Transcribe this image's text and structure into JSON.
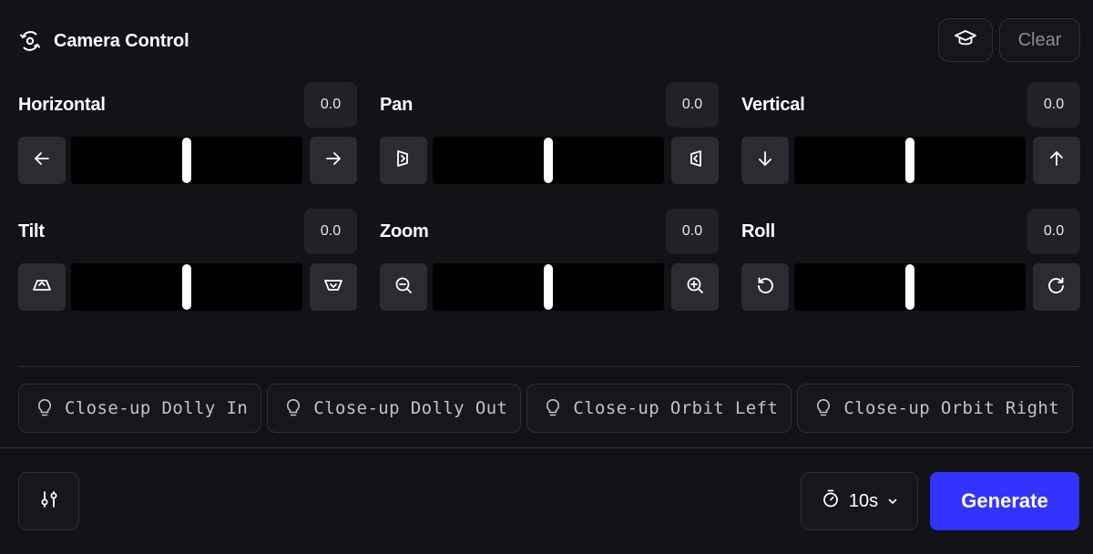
{
  "header": {
    "title": "Camera Control",
    "title_icon": "camera-orbit-icon",
    "learn_icon": "graduation-cap-icon",
    "clear_label": "Clear"
  },
  "controls": [
    {
      "label": "Horizontal",
      "value": "0.0",
      "level": 0.5,
      "left_icon": "arrow-left-icon",
      "right_icon": "arrow-right-icon"
    },
    {
      "label": "Pan",
      "value": "0.0",
      "level": 0.5,
      "left_icon": "pan-left-icon",
      "right_icon": "pan-right-icon"
    },
    {
      "label": "Vertical",
      "value": "0.0",
      "level": 0.5,
      "left_icon": "arrow-down-icon",
      "right_icon": "arrow-up-icon"
    },
    {
      "label": "Tilt",
      "value": "0.0",
      "level": 0.5,
      "left_icon": "tilt-down-icon",
      "right_icon": "tilt-up-icon"
    },
    {
      "label": "Zoom",
      "value": "0.0",
      "level": 0.5,
      "left_icon": "zoom-out-icon",
      "right_icon": "zoom-in-icon"
    },
    {
      "label": "Roll",
      "value": "0.0",
      "level": 0.5,
      "left_icon": "rotate-ccw-icon",
      "right_icon": "rotate-cw-icon"
    }
  ],
  "presets": [
    {
      "label": "Close-up Dolly In"
    },
    {
      "label": "Close-up Dolly Out"
    },
    {
      "label": "Close-up Orbit Left"
    },
    {
      "label": "Close-up Orbit Right"
    }
  ],
  "preset_icon": "lightbulb-icon",
  "footer": {
    "settings_icon": "sliders-icon",
    "duration_icon": "timer-icon",
    "duration_label": "10s",
    "duration_chevron": "chevron-down-icon",
    "generate_label": "Generate"
  },
  "colors": {
    "background": "#131217",
    "slider_track": "#000000",
    "button_bg": "#2c2b31",
    "accent": "#3333ff"
  }
}
